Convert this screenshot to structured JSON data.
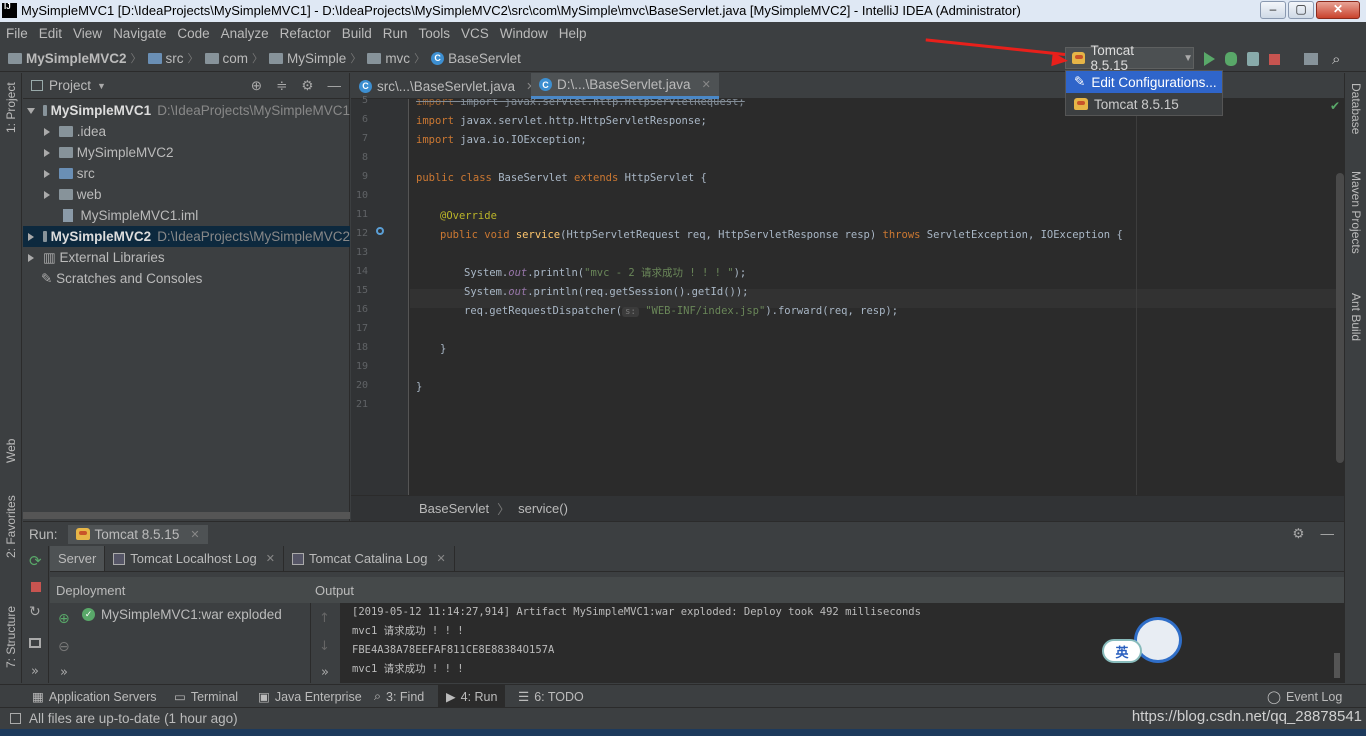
{
  "title": "MySimpleMVC1 [D:\\IdeaProjects\\MySimpleMVC1] - D:\\IdeaProjects\\MySimpleMVC2\\src\\com\\MySimple\\mvc\\BaseServlet.java [MySimpleMVC2] - IntelliJ IDEA (Administrator)",
  "menu": [
    "File",
    "Edit",
    "View",
    "Navigate",
    "Code",
    "Analyze",
    "Refactor",
    "Build",
    "Run",
    "Tools",
    "VCS",
    "Window",
    "Help"
  ],
  "breadcrumb": [
    "MySimpleMVC2",
    "src",
    "com",
    "MySimple",
    "mvc",
    "BaseServlet"
  ],
  "run_config": "Tomcat 8.5.15",
  "dropdown": {
    "items": [
      "Edit Configurations...",
      "Tomcat 8.5.15"
    ]
  },
  "left_tabs": [
    "1: Project",
    "Web",
    "2: Favorites",
    "7: Structure"
  ],
  "right_tabs": [
    "Database",
    "Maven Projects",
    "Ant Build"
  ],
  "project": {
    "header": "Project",
    "tree": [
      {
        "label": "MySimpleMVC1",
        "path": "D:\\IdeaProjects\\MySimpleMVC1"
      },
      {
        "label": ".idea"
      },
      {
        "label": "MySimpleMVC2"
      },
      {
        "label": "src"
      },
      {
        "label": "web"
      },
      {
        "label": "MySimpleMVC1.iml"
      },
      {
        "label": "MySimpleMVC2",
        "path": "D:\\IdeaProjects\\MySimpleMVC2"
      },
      {
        "label": "External Libraries"
      },
      {
        "label": "Scratches and Consoles"
      }
    ]
  },
  "editor": {
    "tabs": [
      "src\\...\\BaseServlet.java",
      "D:\\...\\BaseServlet.java"
    ],
    "line_numbers": [
      "5",
      "6",
      "7",
      "8",
      "9",
      "10",
      "11",
      "12",
      "13",
      "14",
      "15",
      "16",
      "17",
      "18",
      "19",
      "20",
      "21"
    ],
    "code": {
      "l5": "import javax.servlet.http.HttpServletRequest;",
      "l6a": "import ",
      "l6b": "javax.servlet.http.HttpServletResponse;",
      "l7a": "import ",
      "l7b": "java.io.IOException;",
      "l9a": "public class ",
      "l9b": "BaseServlet ",
      "l9c": "extends ",
      "l9d": "HttpServlet {",
      "l11": "@Override",
      "l12a": "public void ",
      "l12b": "service",
      "l12c": "(HttpServletRequest req, HttpServletResponse resp) ",
      "l12d": "throws ",
      "l12e": "ServletException, IOException {",
      "l14a": "System.",
      "l14b": "out",
      "l14c": ".println(",
      "l14d": "\"mvc - 2 请求成功 ! ! ! \"",
      "l14e": ");",
      "l15a": "System.",
      "l15b": "out",
      "l15c": ".println(req.getSession().getId());",
      "l16a": "req.getRequestDispatcher(",
      "l16h": "s:",
      "l16b": "\"WEB-INF/index.jsp\"",
      "l16c": ").forward(req, resp);",
      "l18": "}",
      "l20": "}"
    },
    "breadcrumb": [
      "BaseServlet",
      "service()"
    ]
  },
  "run": {
    "label": "Run:",
    "config": "Tomcat 8.5.15",
    "tabs": [
      "Server",
      "Tomcat Localhost Log",
      "Tomcat Catalina Log"
    ],
    "deployment_header": "Deployment",
    "output_header": "Output",
    "deployment_item": "MySimpleMVC1:war exploded",
    "console": [
      "[2019-05-12 11:14:27,914] Artifact MySimpleMVC1:war exploded: Deploy took 492 milliseconds",
      "mvc1 请求成功 ! ! !",
      "FBE4A38A78EEFAF811CE8E88384O157A",
      "mvc1 请求成功 ! ! !"
    ]
  },
  "bottom_tabs": [
    "Application Servers",
    "Terminal",
    "Java Enterprise",
    "3: Find",
    "4: Run",
    "6: TODO",
    "Event Log"
  ],
  "status": "All files are up-to-date (1 hour ago)",
  "watermark": "https://blog.csdn.net/qq_28878541",
  "ime": "英"
}
